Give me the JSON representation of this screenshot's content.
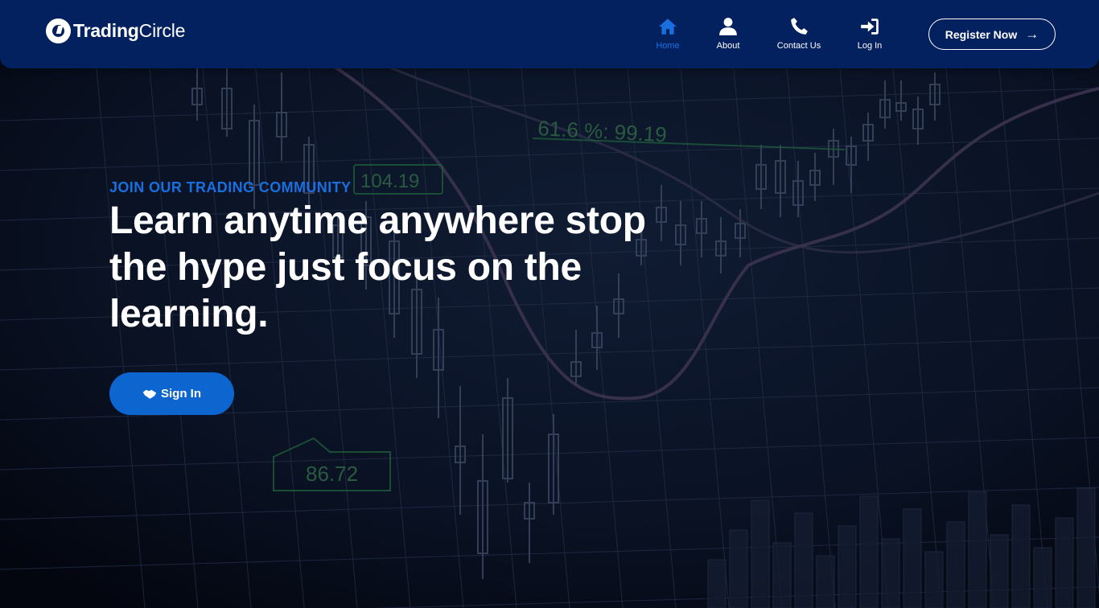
{
  "brand": {
    "name_bold": "Trading",
    "name_light": "Circle"
  },
  "nav": {
    "items": [
      {
        "label": "Home",
        "icon": "home-icon",
        "active": true
      },
      {
        "label": "About",
        "icon": "user-icon",
        "active": false
      },
      {
        "label": "Contact Us",
        "icon": "phone-icon",
        "active": false
      },
      {
        "label": "Log In",
        "icon": "login-icon",
        "active": false
      }
    ],
    "register_label": "Register Now",
    "register_icon": "arrow-right-icon"
  },
  "hero": {
    "eyebrow": "JOIN OUR TRADING COMMUNITY",
    "headline": "Learn anytime anywhere stop the hype just focus on the learning.",
    "signin_label": "Sign In",
    "signin_icon": "handshake-icon",
    "background_labels": [
      "61.6 %:  99.19",
      "104.19",
      "86.72"
    ]
  },
  "colors": {
    "navbar": "#04215f",
    "accent": "#1a6fe0",
    "button": "#0d66d0",
    "background": "#060a18"
  }
}
